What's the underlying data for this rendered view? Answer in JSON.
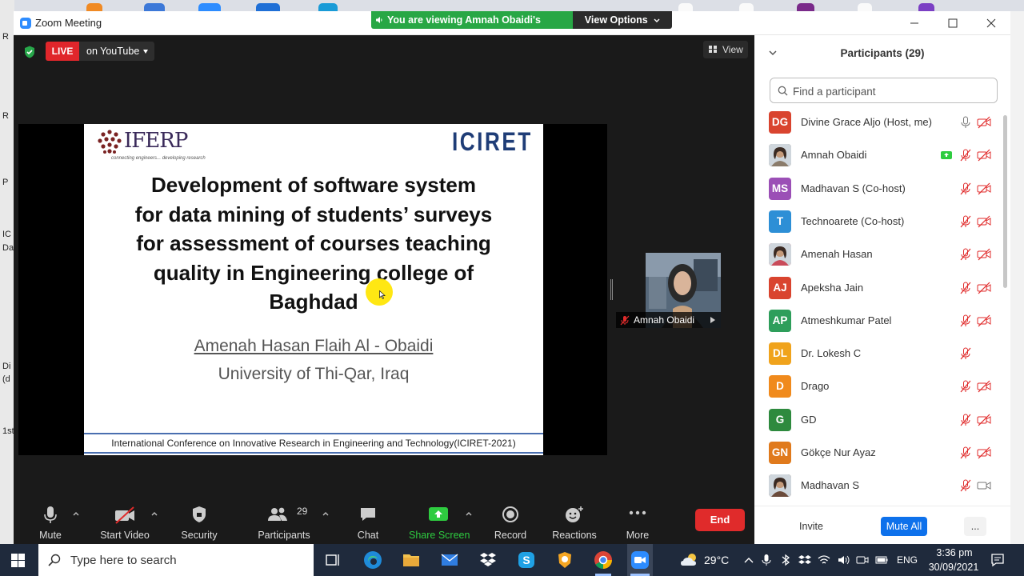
{
  "window": {
    "app_title": "Zoom Meeting",
    "viewing_banner": "You are viewing Amnah Obaidi's screen",
    "view_options_label": "View Options"
  },
  "desktop_fragments": [
    "R",
    "R",
    "P",
    "IC",
    "Da",
    "Di",
    "(d",
    "1st"
  ],
  "meeting": {
    "live_label": "LIVE",
    "live_platform": "on YouTube",
    "view_label": "View",
    "thumbnail_name": "Amnah Obaidi"
  },
  "slide": {
    "logo_left_text": "IFERP",
    "logo_left_tagline": "connecting engineers... developing research",
    "logo_right_text": "ICIRET",
    "title_lines": [
      "Development of software system",
      "for data mining of students’ surveys",
      "for assessment of courses teaching",
      "quality in Engineering college of",
      "Baghdad"
    ],
    "author": "Amenah Hasan Flaih Al - Obaidi",
    "affiliation": "University of Thi-Qar, Iraq",
    "footer": "International Conference on Innovative Research in Engineering and Technology(ICIRET-2021)"
  },
  "toolbar": {
    "mute": "Mute",
    "start_video": "Start Video",
    "security": "Security",
    "participants": "Participants",
    "participants_count": "29",
    "chat": "Chat",
    "share_screen": "Share Screen",
    "record": "Record",
    "reactions": "Reactions",
    "more": "More",
    "end": "End"
  },
  "panel": {
    "title": "Participants (29)",
    "search_placeholder": "Find a participant",
    "invite": "Invite",
    "mute_all": "Mute All",
    "more": "...",
    "participants": [
      {
        "initials": "DG",
        "name": "Divine Grace Aljo (Host, me)",
        "color": "#d9442f",
        "photo": false,
        "mic": "on",
        "video": "off",
        "share": false
      },
      {
        "initials": "",
        "name": "Amnah Obaidi",
        "color": "#8a7b6a",
        "photo": true,
        "mic": "off",
        "video": "off",
        "share": true
      },
      {
        "initials": "MS",
        "name": "Madhavan S (Co-host)",
        "color": "#9b4fb6",
        "photo": false,
        "mic": "off",
        "video": "off",
        "share": false
      },
      {
        "initials": "T",
        "name": "Technoarete (Co-host)",
        "color": "#2d8fd6",
        "photo": false,
        "mic": "off",
        "video": "off",
        "share": false
      },
      {
        "initials": "",
        "name": "Amenah Hasan",
        "color": "#c94b5a",
        "photo": true,
        "mic": "off",
        "video": "off",
        "share": false
      },
      {
        "initials": "AJ",
        "name": "Apeksha Jain",
        "color": "#d9442f",
        "photo": false,
        "mic": "off",
        "video": "off",
        "share": false
      },
      {
        "initials": "AP",
        "name": "Atmeshkumar Patel",
        "color": "#2e9e5b",
        "photo": false,
        "mic": "off",
        "video": "off",
        "share": false
      },
      {
        "initials": "DL",
        "name": "Dr. Lokesh C",
        "color": "#f0a31c",
        "photo": false,
        "mic": "off",
        "video": "none",
        "share": false
      },
      {
        "initials": "D",
        "name": "Drago",
        "color": "#f08a1c",
        "photo": false,
        "mic": "off",
        "video": "off",
        "share": false
      },
      {
        "initials": "G",
        "name": "GD",
        "color": "#2e8a3e",
        "photo": false,
        "mic": "off",
        "video": "off",
        "share": false
      },
      {
        "initials": "GN",
        "name": "Gökçe Nur Ayaz",
        "color": "#e07a1c",
        "photo": false,
        "mic": "off",
        "video": "off",
        "share": false
      },
      {
        "initials": "",
        "name": "Madhavan S",
        "color": "#6a4a3a",
        "photo": true,
        "mic": "off",
        "video": "on",
        "share": false
      }
    ]
  },
  "taskbar": {
    "search_placeholder": "Type here to search",
    "temperature": "29°C",
    "language": "ENG",
    "time": "3:36 pm",
    "date": "30/09/2021"
  }
}
